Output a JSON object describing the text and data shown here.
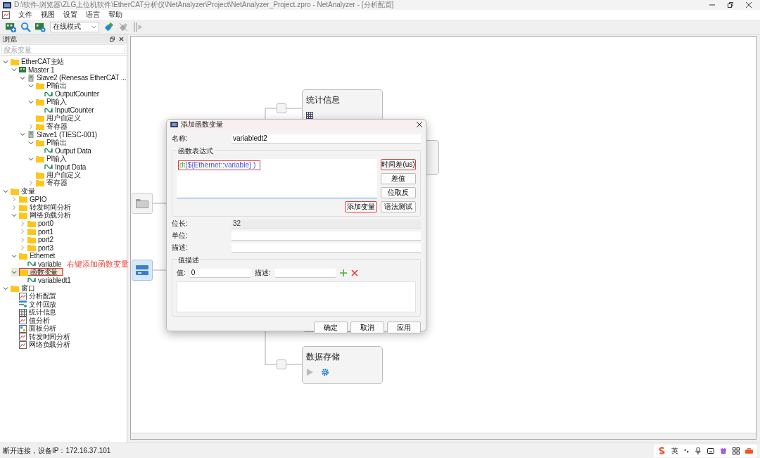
{
  "window": {
    "title": "D:\\软件-浏览器\\ZLG上位机软件\\EtherCAT分析仪\\NetAnalyzer\\Project\\NetAnalyzer_Project.zpro - NetAnalyzer - [分析配置]"
  },
  "menu": [
    "文件",
    "视图",
    "设置",
    "语言",
    "帮助"
  ],
  "toolbar": {
    "mode": "在线模式"
  },
  "browser": {
    "title": "浏览",
    "search": {
      "placeholder": "搜索变量"
    },
    "tree": [
      {
        "label": "EtherCAT主站",
        "kind": "folder",
        "expanded": true,
        "selected": false,
        "boxed": false,
        "children": [
          {
            "label": "Master 1",
            "kind": "master",
            "expanded": true,
            "selected": false,
            "boxed": false,
            "children": [
              {
                "label": "Slave2 (Renesas EtherCAT ...",
                "kind": "slave",
                "expanded": true,
                "selected": false,
                "boxed": false,
                "children": [
                  {
                    "label": "PI输出",
                    "kind": "folder",
                    "expanded": true,
                    "selected": false,
                    "boxed": false,
                    "children": [
                      {
                        "label": "OutputCounter",
                        "kind": "signal",
                        "selected": false,
                        "boxed": false
                      }
                    ]
                  },
                  {
                    "label": "PI输入",
                    "kind": "folder",
                    "expanded": true,
                    "selected": false,
                    "boxed": false,
                    "children": [
                      {
                        "label": "InputCounter",
                        "kind": "signal",
                        "selected": false,
                        "boxed": false
                      }
                    ]
                  },
                  {
                    "label": "用户自定义",
                    "kind": "folder",
                    "selected": false,
                    "boxed": false
                  },
                  {
                    "label": "寄存器",
                    "kind": "folder",
                    "expanded": false,
                    "selected": false,
                    "boxed": false
                  }
                ]
              },
              {
                "label": "Slave1 (TIESC-001)",
                "kind": "slave",
                "expanded": true,
                "selected": false,
                "boxed": false,
                "children": [
                  {
                    "label": "PI输出",
                    "kind": "folder",
                    "expanded": true,
                    "selected": false,
                    "boxed": false,
                    "children": [
                      {
                        "label": "Output Data",
                        "kind": "signal",
                        "selected": false,
                        "boxed": false
                      }
                    ]
                  },
                  {
                    "label": "PI输入",
                    "kind": "folder",
                    "expanded": true,
                    "selected": false,
                    "boxed": false,
                    "children": [
                      {
                        "label": "Input Data",
                        "kind": "signal",
                        "selected": false,
                        "boxed": false
                      }
                    ]
                  },
                  {
                    "label": "用户自定义",
                    "kind": "folder",
                    "selected": false,
                    "boxed": false
                  },
                  {
                    "label": "寄存器",
                    "kind": "folder",
                    "expanded": false,
                    "selected": false,
                    "boxed": false
                  }
                ]
              }
            ]
          }
        ]
      },
      {
        "label": "变量",
        "kind": "folder",
        "expanded": true,
        "selected": false,
        "boxed": false,
        "children": [
          {
            "label": "GPIO",
            "kind": "folder",
            "expanded": false,
            "selected": false,
            "boxed": false
          },
          {
            "label": "转发时间分析",
            "kind": "folder",
            "expanded": false,
            "selected": false,
            "boxed": false
          },
          {
            "label": "网络负载分析",
            "kind": "folder",
            "expanded": true,
            "selected": false,
            "boxed": false,
            "children": [
              {
                "label": "port0",
                "kind": "folder",
                "expanded": false,
                "selected": false,
                "boxed": false
              },
              {
                "label": "port1",
                "kind": "folder",
                "expanded": false,
                "selected": false,
                "boxed": false
              },
              {
                "label": "port2",
                "kind": "folder",
                "expanded": false,
                "selected": false,
                "boxed": false
              },
              {
                "label": "port3",
                "kind": "folder",
                "expanded": false,
                "selected": false,
                "boxed": false
              }
            ]
          },
          {
            "label": "Ethernet",
            "kind": "folder",
            "expanded": true,
            "selected": false,
            "boxed": false,
            "children": [
              {
                "label": "variable",
                "kind": "signal",
                "selected": false,
                "boxed": false
              }
            ]
          },
          {
            "label": "函数变量",
            "kind": "folder",
            "expanded": true,
            "selected": true,
            "boxed": true,
            "children": [
              {
                "label": "variabledt1",
                "kind": "signal",
                "selected": false,
                "boxed": false
              }
            ]
          }
        ]
      },
      {
        "label": "窗口",
        "kind": "folder",
        "expanded": true,
        "selected": false,
        "boxed": false,
        "children": [
          {
            "label": "分析配置",
            "kind": "chart",
            "selected": false,
            "boxed": false
          },
          {
            "label": "文件回放",
            "kind": "playback",
            "selected": false,
            "boxed": false
          },
          {
            "label": "统计信息",
            "kind": "table",
            "selected": false,
            "boxed": false
          },
          {
            "label": "值分析",
            "kind": "chart",
            "selected": false,
            "boxed": false
          },
          {
            "label": "面板分析",
            "kind": "panel",
            "selected": false,
            "boxed": false
          },
          {
            "label": "转发时间分析",
            "kind": "chart",
            "selected": false,
            "boxed": false
          },
          {
            "label": "网络负载分析",
            "kind": "chart",
            "selected": false,
            "boxed": false
          }
        ]
      }
    ]
  },
  "annotation": "右键添加函数变量",
  "canvas": {
    "cards": [
      {
        "title": "统计信息"
      },
      {
        "title": "数据存储"
      }
    ]
  },
  "dialog": {
    "title": "添加函数变量",
    "name": {
      "label": "名称:",
      "value": "variabledt2"
    },
    "expression": {
      "group": "函数表达式",
      "boxed": true,
      "tokens": [
        {
          "text": "dt",
          "kind": "function"
        },
        {
          "text": "(${Ethernet::variable} )",
          "kind": "argument"
        }
      ]
    },
    "side_buttons": [
      {
        "label": "时间差(us)",
        "boxed": true
      },
      {
        "label": "差值",
        "boxed": false
      },
      {
        "label": "位取反",
        "boxed": false
      },
      {
        "label": "语法测试",
        "boxed": false
      }
    ],
    "add_button": {
      "label": "添加变量",
      "boxed": true
    },
    "fields": [
      {
        "label": "位长:",
        "value": "32",
        "disabled": true
      },
      {
        "label": "单位:",
        "disabled": false
      },
      {
        "label": "描述:",
        "disabled": false
      }
    ],
    "value_desc": {
      "group": "值描述",
      "value_label": "值:",
      "value": "0",
      "desc_label": "描述:"
    },
    "buttons": [
      "确定",
      "取消",
      "应用"
    ]
  },
  "status_bar": {
    "text": "断开连接，设备IP：172.16.37.101",
    "ime": "英"
  }
}
